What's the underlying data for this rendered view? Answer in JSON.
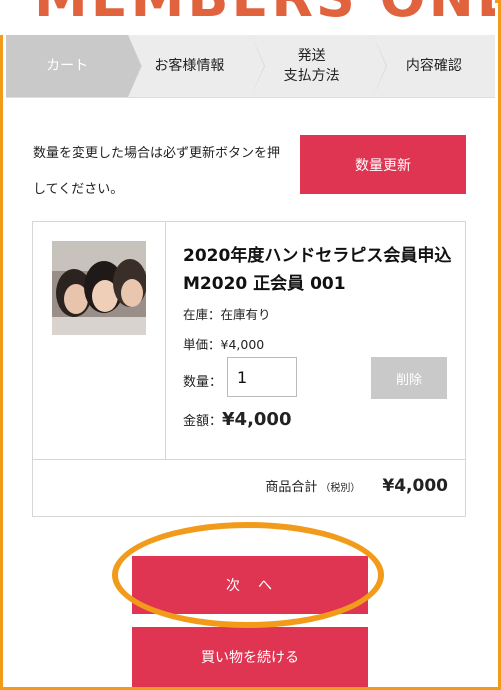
{
  "banner": {
    "text": "MEMBERS ONLY"
  },
  "steps": [
    {
      "label": "カート",
      "active": true
    },
    {
      "label": "お客様情報",
      "active": false
    },
    {
      "label_line1": "発送",
      "label_line2": "支払方法",
      "active": false
    },
    {
      "label": "内容確認",
      "active": false
    }
  ],
  "notice": "数量を変更した場合は必ず更新ボタンを押してください。",
  "update_button": "数量更新",
  "product": {
    "title": "2020年度ハンドセラピス会員申込 M2020 正会員 001",
    "stock_label": "在庫：",
    "stock_value": "在庫有り",
    "unit_price_label": "単価：",
    "unit_price": "¥4,000",
    "quantity_label": "数量：",
    "quantity": "1",
    "delete_label": "削除",
    "amount_label": "金額：",
    "amount": "¥4,000"
  },
  "subtotal": {
    "label": "商品合計",
    "tax_note": "（税別）",
    "value": "¥4,000"
  },
  "next_button": "次　へ",
  "continue_button": "買い物を続ける",
  "colors": {
    "accent": "#df3553",
    "highlight": "#f29a1a"
  }
}
